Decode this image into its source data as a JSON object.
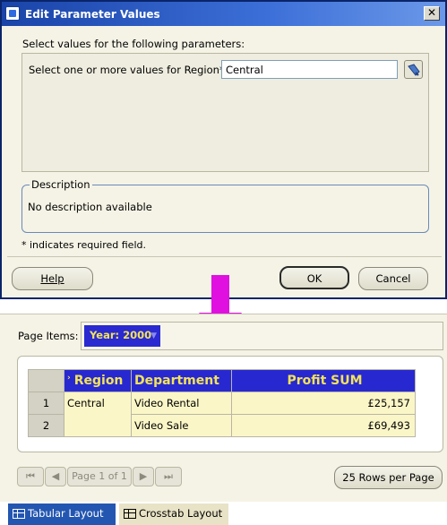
{
  "dialog": {
    "title": "Edit Parameter Values",
    "close_glyph": "✕",
    "prompt": "Select values for the following parameters:",
    "region_label": "Select one or more values for Region*:",
    "region_value": "Central",
    "description_legend": "Description",
    "description_text": "No description available",
    "required_note": "* indicates required field.",
    "buttons": {
      "help": "Help",
      "ok": "OK",
      "cancel": "Cancel"
    }
  },
  "arrow": {
    "color": "#e010e0"
  },
  "report": {
    "page_items_label": "Page Items:",
    "year_item": "Year: 2000",
    "columns": [
      "Region",
      "Department",
      "Profit SUM"
    ],
    "rows": [
      {
        "num": "1",
        "region": "Central",
        "department": "Video Rental",
        "profit": "£25,157"
      },
      {
        "num": "2",
        "region": "",
        "department": "Video Sale",
        "profit": "£69,493"
      }
    ],
    "nav": {
      "page_label": "Page 1 of 1"
    },
    "rows_per_page": "25 Rows per Page"
  },
  "tabs": [
    {
      "label": "Tabular Layout",
      "active": true
    },
    {
      "label": "Crosstab Layout",
      "active": false
    }
  ],
  "colors": {
    "title_bar": "#1a44a8",
    "header_bg": "#2828d0",
    "header_text": "#f2e35a",
    "cell_bg": "#fbf6c7",
    "panel_bg": "#f5f3e6"
  },
  "icons": [
    "app-icon",
    "close-icon",
    "lov-flashlight-icon",
    "sort-caret-icon",
    "first-page-icon",
    "prev-page-icon",
    "next-page-icon",
    "last-page-icon",
    "tabular-layout-icon",
    "crosstab-layout-icon",
    "down-arrow-icon"
  ]
}
